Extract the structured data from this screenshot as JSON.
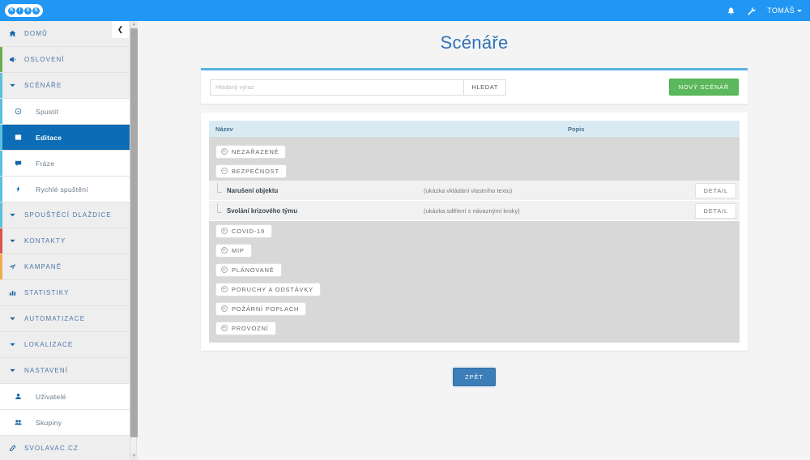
{
  "topbar": {
    "logo_letters": [
      "K",
      "I",
      "S",
      "S"
    ],
    "bell_icon": "bell-icon",
    "wrench_icon": "wrench-icon",
    "user_label": "TOMÁŠ"
  },
  "sidebar": {
    "collapse_icon": "chevron-left-icon",
    "items": [
      {
        "label": "DOMŮ",
        "icon": "home-icon",
        "accent": "",
        "type": "top",
        "active": false
      },
      {
        "label": "OSLOVENÍ",
        "icon": "megaphone-icon",
        "accent": "#6ab04c",
        "type": "top",
        "active": false
      },
      {
        "label": "SCÉNÁŘE",
        "icon": "chevron-down-icon",
        "accent": "#5bc0de",
        "type": "top",
        "active": false
      },
      {
        "label": "Spustit",
        "icon": "clock-icon",
        "accent": "#5bc0de",
        "type": "sub",
        "active": false
      },
      {
        "label": "Editace",
        "icon": "list-icon",
        "accent": "#5bc0de",
        "type": "sub",
        "active": true
      },
      {
        "label": "Fráze",
        "icon": "comment-icon",
        "accent": "#5bc0de",
        "type": "sub",
        "active": false
      },
      {
        "label": "Rychlé spuštění",
        "icon": "bolt-icon",
        "accent": "#5bc0de",
        "type": "sub",
        "active": false
      },
      {
        "label": "SPOUŠTĚCÍ DLAŽDICE",
        "icon": "chevron-down-icon",
        "accent": "#5bc0de",
        "type": "top",
        "active": false
      },
      {
        "label": "KONTAKTY",
        "icon": "chevron-down-icon",
        "accent": "#d9534f",
        "type": "top",
        "active": false
      },
      {
        "label": "KAMPANĚ",
        "icon": "send-icon",
        "accent": "#f0ad4e",
        "type": "top",
        "active": false
      },
      {
        "label": "STATISTIKY",
        "icon": "bar-chart-icon",
        "accent": "",
        "type": "top",
        "active": false
      },
      {
        "label": "AUTOMATIZACE",
        "icon": "chevron-down-icon",
        "accent": "",
        "type": "top",
        "active": false
      },
      {
        "label": "LOKALIZACE",
        "icon": "chevron-down-icon",
        "accent": "",
        "type": "top",
        "active": false
      },
      {
        "label": "NASTAVENÍ",
        "icon": "chevron-down-icon",
        "accent": "",
        "type": "top",
        "active": false
      },
      {
        "label": "Uživatelé",
        "icon": "user-icon",
        "accent": "",
        "type": "sub",
        "active": false
      },
      {
        "label": "Skupiny",
        "icon": "users-icon",
        "accent": "",
        "type": "sub",
        "active": false
      },
      {
        "label": "SVOLAVAC.CZ",
        "icon": "link-icon",
        "accent": "",
        "type": "top",
        "active": false
      }
    ]
  },
  "main": {
    "title": "Scénáře",
    "search": {
      "placeholder": "Hledaný výraz",
      "value": "",
      "button_label": "HLEDAT"
    },
    "new_button_label": "NOVÝ SCÉNÁŘ",
    "table": {
      "columns": [
        "Název",
        "Popis"
      ],
      "groups": [
        {
          "label": "NEZAŘAZENÉ",
          "state": "collapsed",
          "toggle_glyph": "+",
          "items": []
        },
        {
          "label": "BEZPEČNOST",
          "state": "expanded",
          "toggle_glyph": "−",
          "items": [
            {
              "name": "Narušení objektu",
              "desc": "(ukázka vkládání vlastního textu)",
              "action": "DETAIL"
            },
            {
              "name": "Svolání krizového týmu",
              "desc": "(ukázka sdělení s návaznými kroky)",
              "action": "DETAIL"
            }
          ]
        },
        {
          "label": "COVID-19",
          "state": "collapsed",
          "toggle_glyph": "+",
          "items": []
        },
        {
          "label": "MIP",
          "state": "collapsed",
          "toggle_glyph": "+",
          "items": []
        },
        {
          "label": "PLÁNOVANÉ",
          "state": "collapsed",
          "toggle_glyph": "+",
          "items": []
        },
        {
          "label": "PORUCHY A ODSTÁVKY",
          "state": "collapsed",
          "toggle_glyph": "+",
          "items": []
        },
        {
          "label": "POŽÁRNÍ POPLACH",
          "state": "collapsed",
          "toggle_glyph": "+",
          "items": []
        },
        {
          "label": "PROVOZNÍ",
          "state": "collapsed",
          "toggle_glyph": "+",
          "items": []
        }
      ]
    },
    "back_button_label": "ZPĚT"
  },
  "colors": {
    "brand_blue": "#2196f3",
    "active_nav": "#0c6cb5",
    "panel_accent": "#57b5e0",
    "green_button": "#5cb85c",
    "back_button": "#3d7eb8",
    "table_header": "#daeaf3"
  }
}
